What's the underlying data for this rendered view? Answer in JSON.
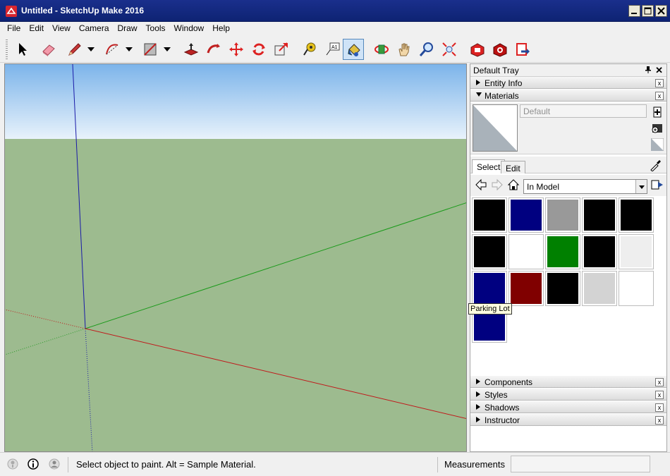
{
  "window": {
    "title": "Untitled - SketchUp Make 2016"
  },
  "menu": [
    "File",
    "Edit",
    "View",
    "Camera",
    "Draw",
    "Tools",
    "Window",
    "Help"
  ],
  "toolbar": {
    "tools": [
      "select-tool",
      "eraser-tool",
      "pencil-tool",
      "arc-tool",
      "rectangle-tool",
      "push-pull-tool",
      "follow-me-tool",
      "move-tool",
      "rotate-tool",
      "scale-tool",
      "tape-measure-tool",
      "text-tool",
      "paint-bucket-tool",
      "orbit-tool",
      "pan-tool",
      "zoom-tool",
      "zoom-extents-tool",
      "get-models-tool",
      "extension-warehouse-tool",
      "send-to-layout-tool"
    ],
    "active_tool": "paint-bucket-tool",
    "text_tool_glyph": "A1"
  },
  "tray": {
    "title": "Default Tray",
    "panels_top": [
      {
        "label": "Entity Info",
        "expanded": false
      },
      {
        "label": "Materials",
        "expanded": true
      }
    ],
    "materials": {
      "name_placeholder": "Default",
      "tabs": [
        "Select",
        "Edit"
      ],
      "library": "In Model",
      "swatches": [
        "#000000",
        "#000080",
        "#999999",
        "#000000",
        "#000000",
        "#000000",
        "#ffffff",
        "#008000",
        "#000000",
        "#eeeeee",
        "#000080",
        "#800000",
        "#000000",
        "#d3d3d3",
        "#ffffff",
        "#000080"
      ],
      "tooltip": "Parking Lot"
    },
    "panels_bottom": [
      {
        "label": "Components",
        "expanded": false
      },
      {
        "label": "Styles",
        "expanded": false
      },
      {
        "label": "Shadows",
        "expanded": false
      },
      {
        "label": "Instructor",
        "expanded": false
      }
    ]
  },
  "statusbar": {
    "message": "Select object to paint. Alt = Sample Material.",
    "measurements_label": "Measurements",
    "measurements_value": ""
  },
  "colors": {
    "titlebar": "#0e2373",
    "sky": "#7cb4ea",
    "ground": "#9dbb8f",
    "x_axis": "#c0191b",
    "y_axis": "#1a9a1a",
    "z_axis": "#1a1aa8"
  }
}
